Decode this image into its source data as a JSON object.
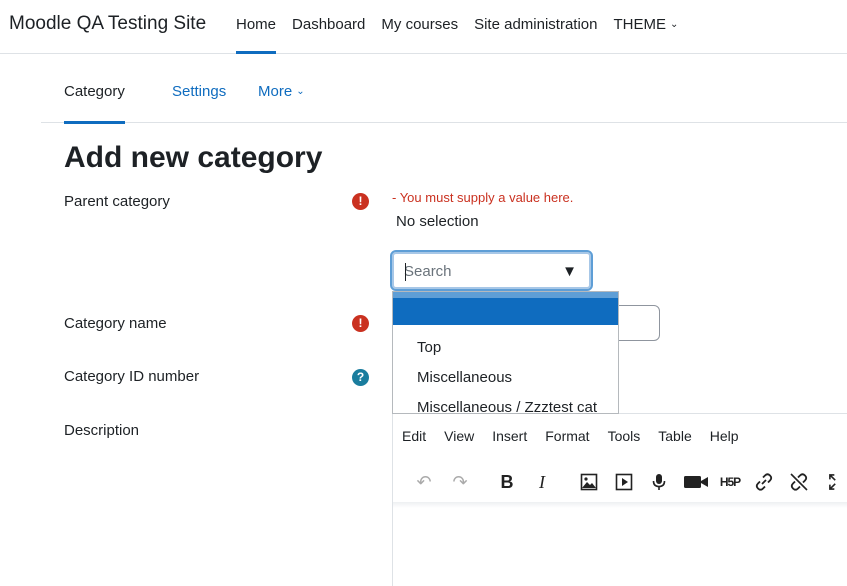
{
  "navbar": {
    "site_name": "Moodle QA Testing Site",
    "items": [
      {
        "label": "Home",
        "active": true
      },
      {
        "label": "Dashboard"
      },
      {
        "label": "My courses"
      },
      {
        "label": "Site administration"
      },
      {
        "label": "THEME",
        "has_dropdown": true
      }
    ]
  },
  "secondary_nav": {
    "items": [
      {
        "label": "Category",
        "active": true
      },
      {
        "label": "Settings"
      },
      {
        "label": "More",
        "has_dropdown": true
      }
    ]
  },
  "page": {
    "title": "Add new category"
  },
  "form": {
    "parent_category": {
      "label": "Parent category",
      "required_icon": "exclamation-icon",
      "error": "- You must supply a value here.",
      "selection": "No selection",
      "search_placeholder": "Search",
      "options": [
        "",
        "Top",
        "Miscellaneous",
        "Miscellaneous / Zzztest cat"
      ],
      "highlighted_index": 0
    },
    "category_name": {
      "label": "Category name",
      "required_icon": "exclamation-icon"
    },
    "category_id_number": {
      "label": "Category ID number",
      "help_icon": "question-icon"
    },
    "description": {
      "label": "Description"
    }
  },
  "editor": {
    "menu": [
      "Edit",
      "View",
      "Insert",
      "Format",
      "Tools",
      "Table",
      "Help"
    ],
    "toolbar": [
      "undo-icon",
      "redo-icon",
      "bold-icon",
      "italic-icon",
      "image-icon",
      "media-icon",
      "microphone-icon",
      "video-camera-icon",
      "h5p-icon",
      "link-icon",
      "unlink-icon",
      "fullscreen-icon"
    ],
    "toolbar_labels": {
      "bold": "B",
      "italic": "I",
      "h5p": "H5P"
    }
  },
  "colors": {
    "accent": "#0f6cbf",
    "error": "#ca3120",
    "help": "#1a7d9e"
  }
}
